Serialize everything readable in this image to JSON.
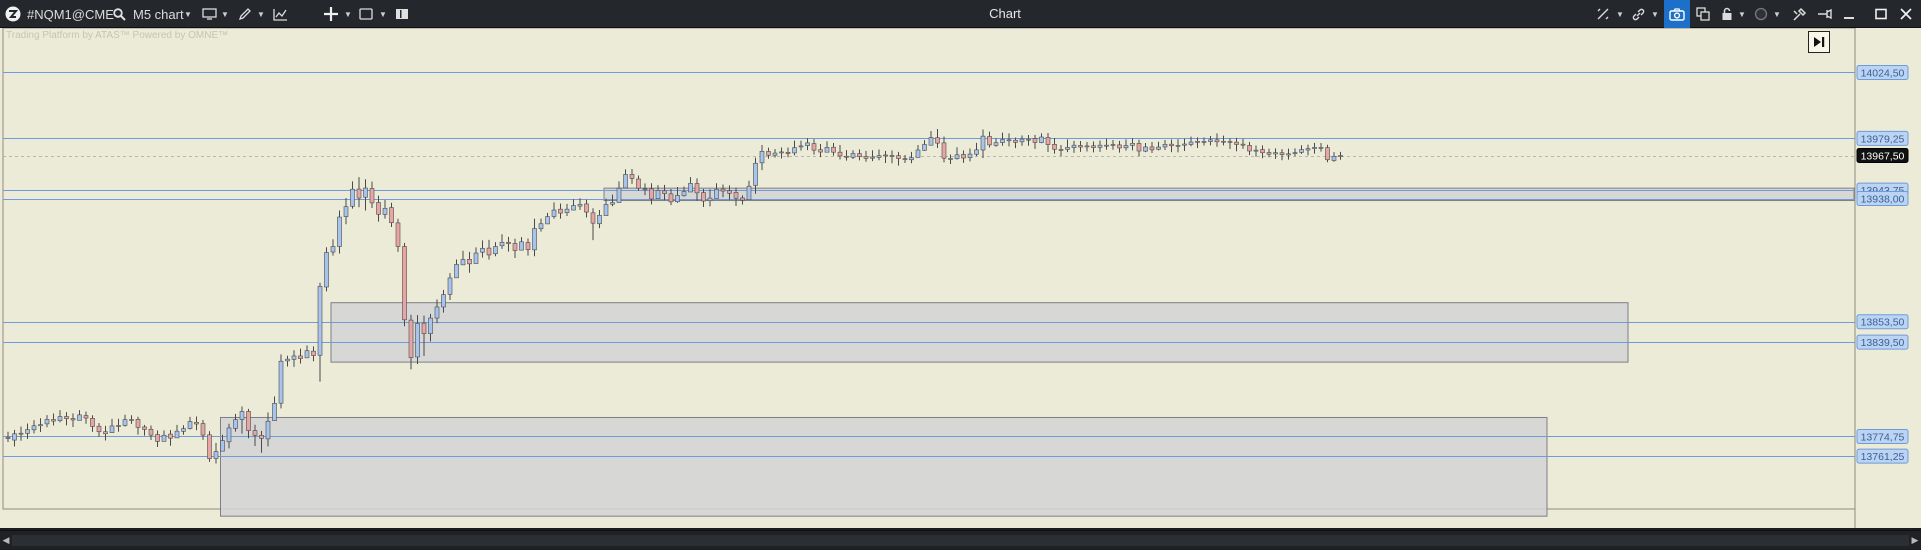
{
  "toolbar": {
    "symbol": "#NQM1@CME",
    "timeframe": "M5 chart",
    "window_title": "Chart"
  },
  "watermark": "Trading Platform by ATAS™  Powered by OMNE™",
  "colors": {
    "background": "#ecebd7",
    "bull_candle": "#a7c4ee",
    "bear_candle": "#e8a5a3",
    "wick": "#4a4a4a",
    "level_line": "#6f9bd8",
    "zone_fill": "#d4d4d6",
    "zone_border": "#7d7f85",
    "current_price_bg": "#111111",
    "active_tool": "#1d70c9"
  },
  "icons": [
    "app-logo-icon",
    "search-icon",
    "monitor-icon",
    "pencil-icon",
    "indicator-icon",
    "crosshair-icon",
    "template-icon",
    "layout-icon",
    "sync-icon",
    "link-icon",
    "camera-icon",
    "copy-icon",
    "lock-icon",
    "theme-icon",
    "tools-icon",
    "pin-icon",
    "minimize-icon",
    "maximize-icon",
    "close-icon",
    "scroll-end-icon"
  ],
  "price_labels": [
    {
      "price": 14024.5,
      "label": "14024,50"
    },
    {
      "price": 13979.25,
      "label": "13979,25"
    },
    {
      "price": 13967.5,
      "label": "13967,50",
      "current": true
    },
    {
      "price": 13943.75,
      "label": "13943,75"
    },
    {
      "price": 13938.0,
      "label": "13938,00"
    },
    {
      "price": 13853.5,
      "label": "13853,50"
    },
    {
      "price": 13839.5,
      "label": "13839,50"
    },
    {
      "price": 13774.75,
      "label": "13774,75"
    },
    {
      "price": 13761.25,
      "label": "13761,25"
    }
  ],
  "zones": [
    {
      "name": "zone-upper",
      "high": 13943.75,
      "low": 13938.0
    },
    {
      "name": "zone-middle",
      "high": 13853.5,
      "low": 13839.5
    },
    {
      "name": "zone-lower",
      "high": 13774.75,
      "low": 13761.25
    }
  ],
  "chart_data": {
    "type": "candlestick",
    "price_axis": {
      "min": 13725,
      "max": 14055
    },
    "candles": [
      [
        13774.2,
        13773.3,
        13778.0,
        13771.0
      ],
      [
        13772.3,
        13776.6,
        13779.3,
        13767.9
      ],
      [
        13777.0,
        13776.6,
        13781.6,
        13771.8
      ],
      [
        13776.9,
        13779.5,
        13783.7,
        13773.0
      ],
      [
        13779.3,
        13782.1,
        13786.0,
        13776.9
      ],
      [
        13782.1,
        13782.9,
        13787.3,
        13777.8
      ],
      [
        13783.4,
        13786.5,
        13789.4,
        13781.1
      ],
      [
        13786.4,
        13785.3,
        13790.5,
        13782.3
      ],
      [
        13785.6,
        13788.4,
        13792.8,
        13784.4
      ],
      [
        13788.5,
        13787.0,
        13791.5,
        13782.4
      ],
      [
        13787.1,
        13786.1,
        13790.6,
        13781.3
      ],
      [
        13785.8,
        13789.6,
        13792.8,
        13787.1
      ],
      [
        13789.1,
        13787.4,
        13791.8,
        13783.5
      ],
      [
        13787.2,
        13781.6,
        13789.3,
        13777.9
      ],
      [
        13781.8,
        13778.0,
        13784.0,
        13774.5
      ],
      [
        13778.0,
        13776.6,
        13782.0,
        13772.0
      ],
      [
        13777.4,
        13782.0,
        13786.8,
        13777.1
      ],
      [
        13782.3,
        13781.8,
        13786.9,
        13778.0
      ],
      [
        13782.3,
        13786.3,
        13789.7,
        13781.5
      ],
      [
        13786.4,
        13785.9,
        13789.3,
        13783.4
      ],
      [
        13786.5,
        13781.0,
        13788.3,
        13776.0
      ],
      [
        13781.3,
        13779.6,
        13782.7,
        13775.3
      ],
      [
        13779.7,
        13775.7,
        13782.3,
        13772.3
      ],
      [
        13776.1,
        13771.4,
        13778.9,
        13767.5
      ],
      [
        13771.4,
        13775.6,
        13778.9,
        13772.7
      ],
      [
        13776.4,
        13773.6,
        13779.2,
        13768.4
      ],
      [
        13773.8,
        13778.4,
        13782.7,
        13775.3
      ],
      [
        13778.3,
        13780.1,
        13782.5,
        13775.9
      ],
      [
        13780.2,
        13785.0,
        13788.2,
        13779.5
      ],
      [
        13784.5,
        13783.3,
        13788.5,
        13779.0
      ],
      [
        13783.6,
        13775.7,
        13786.1,
        13772.4
      ],
      [
        13775.9,
        13759.6,
        13778.4,
        13757.3
      ],
      [
        13759.7,
        13764.4,
        13770.4,
        13756.2
      ],
      [
        13764.7,
        13771.9,
        13775.9,
        13767.7
      ],
      [
        13771.1,
        13780.6,
        13783.5,
        13766.6
      ],
      [
        13780.3,
        13786.3,
        13790.3,
        13778.1
      ],
      [
        13786.4,
        13791.9,
        13795.3,
        13776.7
      ],
      [
        13791.9,
        13778.8,
        13793.7,
        13773.5
      ],
      [
        13778.8,
        13775.6,
        13782.8,
        13768.2
      ],
      [
        13775.5,
        13773.5,
        13778.6,
        13763.6
      ],
      [
        13773.1,
        13785.2,
        13791.3,
        13768.0
      ],
      [
        13785.6,
        13797.5,
        13802.3,
        13788.0
      ],
      [
        13797.6,
        13826.4,
        13831.1,
        13794.0
      ],
      [
        13826.6,
        13827.8,
        13830.1,
        13822.8
      ],
      [
        13827.7,
        13830.0,
        13833.9,
        13822.5
      ],
      [
        13830.0,
        13828.2,
        13835.0,
        13824.7
      ],
      [
        13828.7,
        13833.6,
        13837.3,
        13828.7
      ],
      [
        13833.3,
        13830.3,
        13836.6,
        13826.4
      ],
      [
        13830.5,
        13877.8,
        13880.2,
        13812.4
      ],
      [
        13877.3,
        13901.0,
        13904.6,
        13874.3
      ],
      [
        13901.3,
        13905.1,
        13910.1,
        13898.8
      ],
      [
        13905.1,
        13925.3,
        13929.8,
        13900.3
      ],
      [
        13925.6,
        13932.4,
        13938.4,
        13920.4
      ],
      [
        13932.7,
        13944.4,
        13949.8,
        13931.1
      ],
      [
        13944.5,
        13938.3,
        13952.7,
        13932.0
      ],
      [
        13938.9,
        13945.2,
        13951.2,
        13929.8
      ],
      [
        13944.9,
        13935.0,
        13949.6,
        13931.5
      ],
      [
        13935.3,
        13927.2,
        13940.0,
        13922.2
      ],
      [
        13927.1,
        13931.3,
        13937.0,
        13924.2
      ],
      [
        13931.8,
        13921.4,
        13935.1,
        13918.5
      ],
      [
        13921.3,
        13905.2,
        13924.1,
        13901.4
      ],
      [
        13905.1,
        13854.8,
        13907.6,
        13850.4
      ],
      [
        13854.6,
        13828.9,
        13858.3,
        13820.8
      ],
      [
        13829.3,
        13852.3,
        13858.0,
        13824.4
      ],
      [
        13852.5,
        13845.3,
        13857.7,
        13830.0
      ],
      [
        13845.3,
        13856.0,
        13858.9,
        13839.9
      ],
      [
        13856.0,
        13863.6,
        13868.8,
        13852.4
      ],
      [
        13863.6,
        13872.1,
        13875.3,
        13859.7
      ],
      [
        13872.3,
        13883.5,
        13886.8,
        13868.4
      ],
      [
        13883.6,
        13892.8,
        13896.2,
        13888.9
      ],
      [
        13892.5,
        13896.2,
        13902.2,
        13893.2
      ],
      [
        13896.3,
        13893.2,
        13901.4,
        13887.1
      ],
      [
        13893.4,
        13900.6,
        13904.5,
        13895.8
      ],
      [
        13901.2,
        13903.8,
        13909.3,
        13897.5
      ],
      [
        13904.0,
        13899.3,
        13909.6,
        13896.1
      ],
      [
        13900.1,
        13905.1,
        13908.1,
        13898.4
      ],
      [
        13905.6,
        13908.0,
        13913.5,
        13903.5
      ],
      [
        13908.0,
        13907.1,
        13911.7,
        13901.6
      ],
      [
        13907.2,
        13902.4,
        13910.4,
        13897.2
      ],
      [
        13902.6,
        13908.3,
        13911.5,
        13904.0
      ],
      [
        13907.8,
        13903.0,
        13910.6,
        13898.8
      ],
      [
        13902.8,
        13917.4,
        13924.1,
        13898.4
      ],
      [
        13917.3,
        13920.7,
        13924.3,
        13915.3
      ],
      [
        13920.6,
        13925.6,
        13928.2,
        13921.9
      ],
      [
        13925.7,
        13930.1,
        13935.4,
        13924.1
      ],
      [
        13930.7,
        13928.0,
        13934.6,
        13924.2
      ],
      [
        13928.3,
        13930.7,
        13934.3,
        13926.0
      ],
      [
        13930.1,
        13933.2,
        13937.5,
        13929.9
      ],
      [
        13932.8,
        13934.0,
        13938.2,
        13930.2
      ],
      [
        13934.3,
        13928.7,
        13937.2,
        13925.0
      ],
      [
        13928.2,
        13921.1,
        13931.3,
        13909.5
      ],
      [
        13920.7,
        13926.5,
        13930.1,
        13917.7
      ],
      [
        13926.3,
        13934.0,
        13937.9,
        13928.4
      ],
      [
        13934.1,
        13935.3,
        13940.7,
        13932.7
      ],
      [
        13935.3,
        13945.1,
        13949.8,
        13938.9
      ],
      [
        13945.3,
        13954.5,
        13958.0,
        13948.8
      ],
      [
        13954.6,
        13951.8,
        13958.3,
        13948.1
      ],
      [
        13951.4,
        13945.1,
        13953.8,
        13943.3
      ],
      [
        13944.7,
        13944.2,
        13948.4,
        13940.3
      ],
      [
        13944.6,
        13937.7,
        13948.5,
        13934.0
      ],
      [
        13937.9,
        13943.6,
        13947.2,
        13940.0
      ],
      [
        13943.3,
        13941.4,
        13947.4,
        13936.9
      ],
      [
        13941.2,
        13935.7,
        13944.5,
        13933.5
      ],
      [
        13935.8,
        13940.1,
        13945.9,
        13935.0
      ],
      [
        13939.9,
        13942.8,
        13946.3,
        13939.3
      ],
      [
        13942.5,
        13948.4,
        13952.7,
        13944.5
      ],
      [
        13948.3,
        13941.9,
        13951.8,
        13936.5
      ],
      [
        13942.1,
        13936.3,
        13944.6,
        13932.2
      ],
      [
        13936.5,
        13938.3,
        13944.4,
        13932.6
      ],
      [
        13938.0,
        13944.3,
        13948.5,
        13939.9
      ],
      [
        13944.5,
        13943.1,
        13947.6,
        13938.9
      ],
      [
        13943.4,
        13941.6,
        13947.0,
        13937.2
      ],
      [
        13942.2,
        13938.2,
        13945.5,
        13932.9
      ],
      [
        13938.4,
        13936.9,
        13940.2,
        13933.9
      ],
      [
        13937.2,
        13946.5,
        13950.2,
        13941.5
      ],
      [
        13947.0,
        13962.2,
        13966.1,
        13941.3
      ],
      [
        13962.5,
        13970.4,
        13974.7,
        13957.5
      ],
      [
        13970.3,
        13967.7,
        13972.9,
        13965.3
      ],
      [
        13967.7,
        13969.2,
        13972.0,
        13966.1
      ],
      [
        13969.4,
        13970.0,
        13973.0,
        13965.5
      ],
      [
        13969.7,
        13968.9,
        13973.0,
        13966.3
      ],
      [
        13969.3,
        13972.9,
        13977.7,
        13967.6
      ],
      [
        13973.4,
        13974.1,
        13977.7,
        13970.9
      ],
      [
        13974.3,
        13976.2,
        13979.4,
        13971.2
      ],
      [
        13975.7,
        13971.2,
        13978.8,
        13968.1
      ],
      [
        13971.5,
        13969.9,
        13975.4,
        13966.4
      ],
      [
        13969.8,
        13973.1,
        13977.3,
        13970.1
      ],
      [
        13973.2,
        13969.8,
        13976.1,
        13967.4
      ],
      [
        13969.8,
        13967.2,
        13974.7,
        13964.8
      ],
      [
        13967.0,
        13966.9,
        13971.2,
        13964.0
      ],
      [
        13966.3,
        13968.9,
        13971.1,
        13965.1
      ],
      [
        13968.8,
        13966.8,
        13971.7,
        13964.2
      ],
      [
        13966.8,
        13965.6,
        13970.7,
        13963.2
      ],
      [
        13965.7,
        13966.5,
        13971.1,
        13963.7
      ],
      [
        13966.2,
        13967.4,
        13971.6,
        13964.3
      ],
      [
        13967.9,
        13967.3,
        13970.7,
        13962.4
      ],
      [
        13967.6,
        13966.8,
        13971.0,
        13962.2
      ],
      [
        13967.4,
        13965.5,
        13970.0,
        13960.6
      ],
      [
        13965.4,
        13964.7,
        13967.9,
        13962.4
      ],
      [
        13964.6,
        13966.0,
        13970.0,
        13962.2
      ],
      [
        13966.2,
        13971.3,
        13974.7,
        13968.2
      ],
      [
        13971.1,
        13975.1,
        13978.1,
        13970.7
      ],
      [
        13974.6,
        13979.8,
        13984.3,
        13974.6
      ],
      [
        13979.7,
        13976.0,
        13985.7,
        13972.7
      ],
      [
        13976.2,
        13965.7,
        13980.6,
        13962.8
      ],
      [
        13965.5,
        13965.1,
        13968.2,
        13961.7
      ],
      [
        13965.3,
        13968.0,
        13973.2,
        13964.7
      ],
      [
        13968.3,
        13965.8,
        13971.0,
        13962.5
      ],
      [
        13966.0,
        13968.5,
        13972.3,
        13963.5
      ],
      [
        13968.4,
        13971.4,
        13976.2,
        13967.1
      ],
      [
        13971.3,
        13980.8,
        13985.4,
        13965.7
      ],
      [
        13980.6,
        13974.8,
        13983.9,
        13973.0
      ],
      [
        13974.5,
        13976.3,
        13979.3,
        13973.5
      ],
      [
        13976.4,
        13978.5,
        13983.2,
        13974.2
      ],
      [
        13978.2,
        13978.3,
        13982.7,
        13973.8
      ],
      [
        13978.0,
        13976.5,
        13979.8,
        13972.6
      ],
      [
        13976.9,
        13978.8,
        13981.3,
        13974.2
      ],
      [
        13978.6,
        13978.7,
        13981.6,
        13974.2
      ],
      [
        13979.1,
        13976.5,
        13981.7,
        13972.1
      ],
      [
        13976.4,
        13980.2,
        13982.7,
        13975.9
      ],
      [
        13979.9,
        13975.0,
        13983.0,
        13969.9
      ],
      [
        13975.2,
        13971.8,
        13979.5,
        13968.8
      ],
      [
        13971.7,
        13971.5,
        13974.7,
        13967.1
      ],
      [
        13971.7,
        13973.1,
        13978.6,
        13969.8
      ],
      [
        13972.9,
        13974.6,
        13977.6,
        13969.3
      ],
      [
        13974.4,
        13973.3,
        13977.5,
        13970.0
      ],
      [
        13973.5,
        13974.1,
        13976.8,
        13970.3
      ],
      [
        13974.2,
        13973.0,
        13977.1,
        13969.7
      ],
      [
        13973.1,
        13974.6,
        13977.8,
        13970.0
      ],
      [
        13974.5,
        13974.6,
        13979.1,
        13971.5
      ],
      [
        13975.1,
        13974.8,
        13978.2,
        13971.5
      ],
      [
        13974.8,
        13972.7,
        13977.6,
        13969.5
      ],
      [
        13972.8,
        13974.4,
        13978.6,
        13970.9
      ],
      [
        13974.5,
        13975.9,
        13979.4,
        13971.0
      ],
      [
        13975.8,
        13970.6,
        13978.4,
        13967.2
      ],
      [
        13970.5,
        13973.4,
        13976.1,
        13969.8
      ],
      [
        13973.4,
        13971.4,
        13976.8,
        13969.2
      ],
      [
        13971.8,
        13973.3,
        13977.0,
        13971.0
      ],
      [
        13973.4,
        13975.2,
        13978.2,
        13971.3
      ],
      [
        13975.3,
        13974.2,
        13978.5,
        13969.8
      ],
      [
        13974.2,
        13974.5,
        13978.7,
        13969.7
      ],
      [
        13974.6,
        13975.4,
        13979.1,
        13970.6
      ],
      [
        13975.1,
        13976.8,
        13980.5,
        13973.9
      ],
      [
        13977.3,
        13976.5,
        13980.0,
        13972.7
      ],
      [
        13976.7,
        13977.2,
        13979.9,
        13974.4
      ],
      [
        13977.1,
        13978.3,
        13980.9,
        13974.5
      ],
      [
        13978.3,
        13976.9,
        13982.7,
        13973.5
      ],
      [
        13977.3,
        13977.2,
        13981.2,
        13974.5
      ],
      [
        13977.2,
        13976.6,
        13979.4,
        13972.0
      ],
      [
        13976.7,
        13975.1,
        13979.6,
        13970.4
      ],
      [
        13975.3,
        13974.6,
        13979.0,
        13972.1
      ],
      [
        13974.4,
        13970.6,
        13976.9,
        13967.8
      ],
      [
        13970.6,
        13971.2,
        13974.4,
        13966.7
      ],
      [
        13971.6,
        13969.4,
        13974.5,
        13965.6
      ],
      [
        13969.6,
        13968.4,
        13972.2,
        13966.3
      ],
      [
        13968.6,
        13969.5,
        13972.4,
        13965.2
      ],
      [
        13969.4,
        13968.1,
        13971.9,
        13964.3
      ],
      [
        13967.9,
        13968.7,
        13972.2,
        13964.7
      ],
      [
        13968.9,
        13969.5,
        13972.4,
        13967.0
      ],
      [
        13969.7,
        13971.6,
        13974.6,
        13968.6
      ],
      [
        13971.3,
        13972.2,
        13975.0,
        13967.6
      ],
      [
        13972.3,
        13973.1,
        13976.2,
        13968.8
      ],
      [
        13972.9,
        13973.1,
        13976.1,
        13970.2
      ],
      [
        13972.9,
        13964.6,
        13974.9,
        13962.9
      ],
      [
        13964.1,
        13966.9,
        13969.8,
        13963.2
      ],
      [
        13967.1,
        13967.5,
        13970.0,
        13964.6
      ]
    ]
  }
}
